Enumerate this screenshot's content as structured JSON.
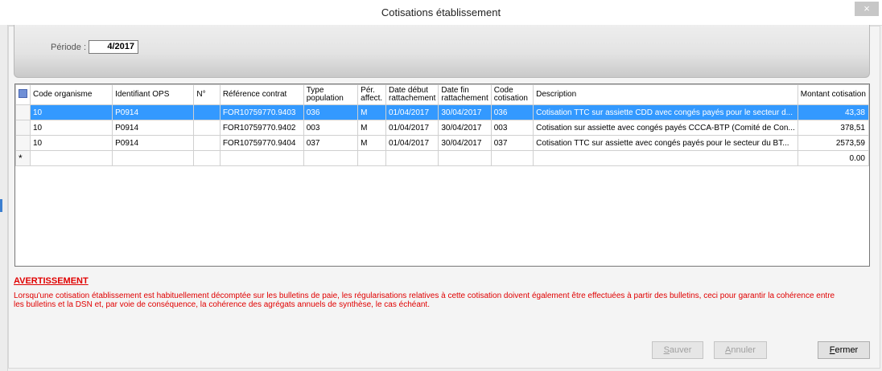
{
  "window": {
    "title": "Cotisations établissement",
    "close_glyph": "×"
  },
  "filter": {
    "periode_label": "Période :",
    "periode_value": "4/2017"
  },
  "table": {
    "columns": [
      "Code organisme",
      "Identifiant OPS",
      "N°",
      "Référence contrat",
      "Type population",
      "Pér. affect.",
      "Date début rattachement",
      "Date fin rattachement",
      "Code cotisation",
      "Description",
      "Montant cotisation"
    ],
    "rows": [
      [
        "10",
        "P0914",
        "",
        "FOR10759770.9403",
        "036",
        "M",
        "01/04/2017",
        "30/04/2017",
        "036",
        "Cotisation TTC sur assiette CDD avec congés payés pour le secteur d...",
        "43,38"
      ],
      [
        "10",
        "P0914",
        "",
        "FOR10759770.9402",
        "003",
        "M",
        "01/04/2017",
        "30/04/2017",
        "003",
        "Cotisation sur assiette avec congés payés CCCA-BTP (Comité de Con...",
        "378,51"
      ],
      [
        "10",
        "P0914",
        "",
        "FOR10759770.9404",
        "037",
        "M",
        "01/04/2017",
        "30/04/2017",
        "037",
        "Cotisation TTC sur assiette avec congés payés pour le secteur du BT...",
        "2573,59"
      ]
    ],
    "new_row_marker": "*",
    "new_row_amount": "0.00",
    "selected_row": 0
  },
  "warning": {
    "title": "AVERTISSEMENT",
    "text": "Lorsqu'une cotisation établissement est habituellement décomptée sur les bulletins de paie, les régularisations relatives à cette cotisation doivent également être effectuées à partir des bulletins, ceci pour garantir la cohérence entre les bulletins et la DSN et, par voie de conséquence, la cohérence des agrégats annuels de synthèse, le cas échéant."
  },
  "buttons": {
    "save": {
      "accel": "S",
      "rest": "auver"
    },
    "cancel": {
      "accel": "A",
      "rest": "nnuler"
    },
    "close": {
      "accel": "F",
      "rest": "ermer"
    }
  },
  "colors": {
    "selection": "#3399ff",
    "warning": "#e00000"
  }
}
